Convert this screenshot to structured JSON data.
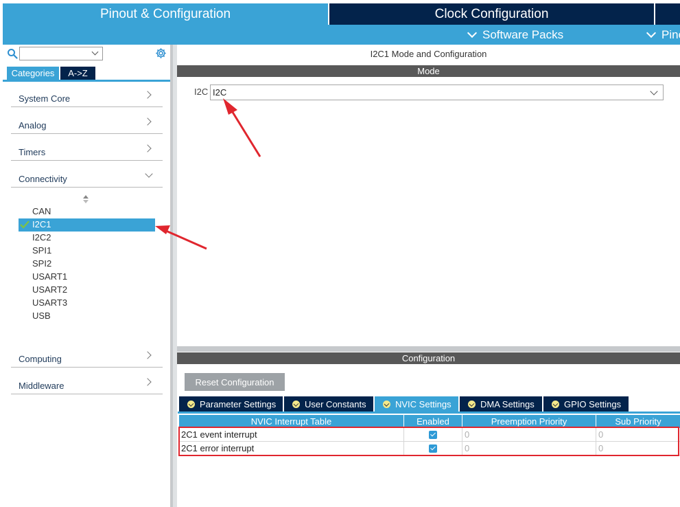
{
  "top_tabs": {
    "pinout": "Pinout & Configuration",
    "clock": "Clock Configuration"
  },
  "subbar": {
    "software_packs": "Software Packs",
    "pinout_truncated": "Pino"
  },
  "left": {
    "search": {
      "placeholder": ""
    },
    "tabs": {
      "categories": "Categories",
      "az": "A->Z"
    },
    "categories": [
      {
        "label": "System Core"
      },
      {
        "label": "Analog"
      },
      {
        "label": "Timers"
      },
      {
        "label": "Connectivity"
      },
      {
        "label": "Computing"
      },
      {
        "label": "Middleware"
      }
    ],
    "connectivity_items": [
      "CAN",
      "I2C1",
      "I2C2",
      "SPI1",
      "SPI2",
      "USART1",
      "USART2",
      "USART3",
      "USB"
    ],
    "selected_item": "I2C1"
  },
  "mode": {
    "title": "I2C1 Mode and Configuration",
    "bar": "Mode",
    "i2c_label": "I2C",
    "i2c_value": "I2C"
  },
  "configuration": {
    "bar": "Configuration",
    "reset_button": "Reset Configuration",
    "tabs": [
      "Parameter Settings",
      "User Constants",
      "NVIC Settings",
      "DMA Settings",
      "GPIO Settings"
    ],
    "active_tab": "NVIC Settings",
    "table": {
      "headers": [
        "NVIC Interrupt Table",
        "Enabled",
        "Preemption Priority",
        "Sub Priority"
      ],
      "rows": [
        {
          "name": "2C1 event interrupt",
          "enabled": true,
          "preemption": "0",
          "sub": "0"
        },
        {
          "name": "2C1 error interrupt",
          "enabled": true,
          "preemption": "0",
          "sub": "0"
        }
      ]
    }
  },
  "colors": {
    "accent": "#3aa3d6",
    "dark": "#03234b",
    "annotation": "#e0262e"
  }
}
